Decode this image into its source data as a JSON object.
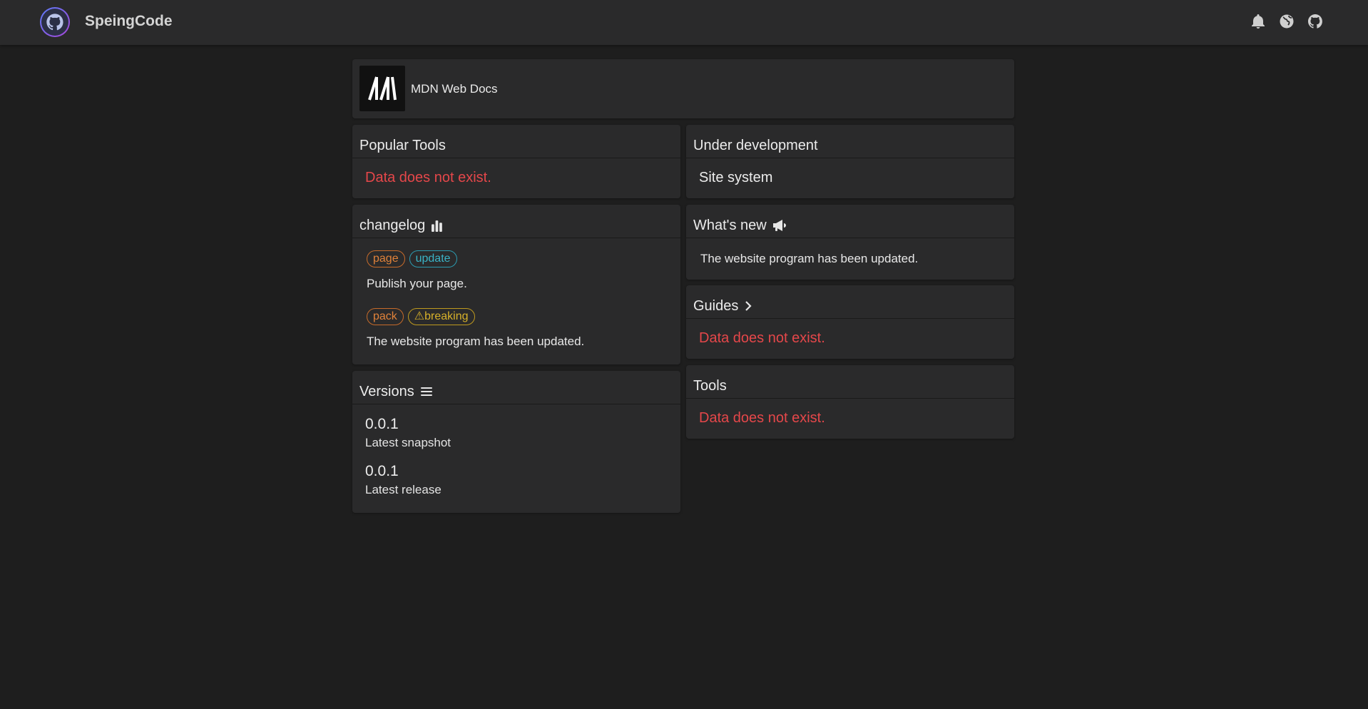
{
  "header": {
    "brand": "SpeingCode",
    "icons": [
      "bell-icon",
      "globe-icon",
      "github-icon"
    ]
  },
  "featured": {
    "label": "MDN Web Docs",
    "logo_text": "M"
  },
  "popular_tools": {
    "title": "Popular Tools",
    "message": "Data does not exist."
  },
  "under_development": {
    "title": "Under development",
    "item": "Site system"
  },
  "changelog": {
    "title": "changelog",
    "entries": [
      {
        "tags": [
          "page",
          "update"
        ],
        "text": "Publish your page."
      },
      {
        "tags": [
          "pack",
          "⚠breaking"
        ],
        "text": "The website program has been updated."
      }
    ]
  },
  "whats_new": {
    "title": "What's new",
    "text": "The website program has been updated."
  },
  "guides": {
    "title": "Guides",
    "message": "Data does not exist."
  },
  "versions": {
    "title": "Versions",
    "items": [
      {
        "number": "0.0.1",
        "label": "Latest snapshot"
      },
      {
        "number": "0.0.1",
        "label": "Latest release"
      }
    ]
  },
  "tools": {
    "title": "Tools",
    "message": "Data does not exist."
  },
  "colors": {
    "background": "#1e1e1e",
    "card": "#2a2a2b",
    "error": "#e5474a",
    "tag_orange": "#e0823a",
    "tag_cyan": "#3ab3c6",
    "tag_yellow": "#d7b12a"
  }
}
